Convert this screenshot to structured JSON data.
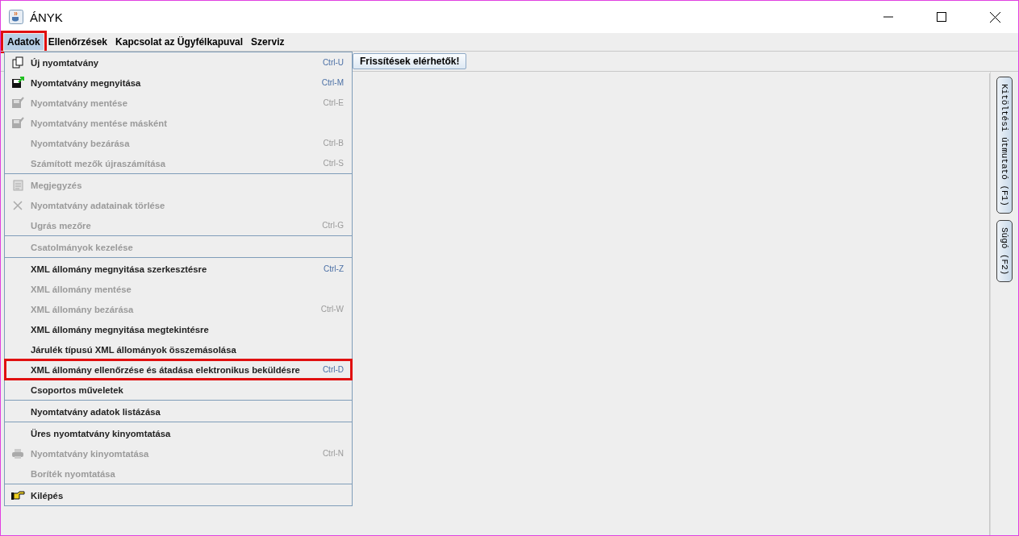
{
  "window": {
    "title": "ÁNYK"
  },
  "menubar": [
    {
      "label": "Adatok",
      "selected": true,
      "highlighted": true
    },
    {
      "label": "Ellenőrzések",
      "selected": false,
      "highlighted": false
    },
    {
      "label": "Kapcsolat az Ügyfélkapuval",
      "selected": false,
      "highlighted": false
    },
    {
      "label": "Szerviz",
      "selected": false,
      "highlighted": false
    }
  ],
  "toolbar": {
    "update_button": "Frissítések elérhetők!"
  },
  "menu": {
    "groups": [
      [
        {
          "label": "Új nyomtatvány",
          "shortcut": "Ctrl-U",
          "disabled": false,
          "highlighted": false,
          "kind": "pages"
        },
        {
          "label": "Nyomtatvány megnyitása",
          "shortcut": "Ctrl-M",
          "disabled": false,
          "highlighted": false,
          "kind": "open"
        },
        {
          "label": "Nyomtatvány mentése",
          "shortcut": "Ctrl-E",
          "disabled": true,
          "highlighted": false,
          "kind": "save"
        },
        {
          "label": "Nyomtatvány mentése másként",
          "disabled": true,
          "highlighted": false,
          "kind": "save"
        },
        {
          "label": "Nyomtatvány bezárása",
          "shortcut": "Ctrl-B",
          "disabled": true,
          "highlighted": false
        },
        {
          "label": "Számított mezők újraszámítása",
          "shortcut": "Ctrl-S",
          "disabled": true,
          "highlighted": false
        }
      ],
      [
        {
          "label": "Megjegyzés",
          "disabled": true,
          "highlighted": false,
          "kind": "note"
        },
        {
          "label": "Nyomtatvány adatainak törlése",
          "disabled": true,
          "highlighted": false,
          "kind": "cross"
        },
        {
          "label": "Ugrás mezőre",
          "shortcut": "Ctrl-G",
          "disabled": true,
          "highlighted": false
        }
      ],
      [
        {
          "label": "Csatolmányok kezelése",
          "disabled": true,
          "highlighted": false
        }
      ],
      [
        {
          "label": "XML állomány megnyitása szerkesztésre",
          "shortcut": "Ctrl-Z",
          "disabled": false,
          "highlighted": false
        },
        {
          "label": "XML állomány mentése",
          "disabled": true,
          "highlighted": false
        },
        {
          "label": "XML állomány bezárása",
          "shortcut": "Ctrl-W",
          "disabled": true,
          "highlighted": false
        },
        {
          "label": "XML állomány megnyitása megtekintésre",
          "disabled": false,
          "highlighted": false
        },
        {
          "label": "Járulék típusú XML állományok összemásolása",
          "disabled": false,
          "highlighted": false
        },
        {
          "label": "XML állomány ellenőrzése és átadása elektronikus beküldésre",
          "shortcut": "Ctrl-D",
          "disabled": false,
          "highlighted": true
        },
        {
          "label": "Csoportos műveletek",
          "disabled": false,
          "highlighted": false
        }
      ],
      [
        {
          "label": "Nyomtatvány adatok listázása",
          "disabled": false,
          "highlighted": false
        }
      ],
      [
        {
          "label": "Üres nyomtatvány kinyomtatása",
          "disabled": false,
          "highlighted": false
        },
        {
          "label": "Nyomtatvány kinyomtatása",
          "shortcut": "Ctrl-N",
          "disabled": true,
          "highlighted": false,
          "kind": "printer"
        },
        {
          "label": "Boríték nyomtatása",
          "disabled": true,
          "highlighted": false
        }
      ],
      [
        {
          "label": "Kilépés",
          "disabled": false,
          "highlighted": false,
          "kind": "hand"
        }
      ]
    ]
  },
  "side_tabs": [
    "Kitöltési útmutató (F1)",
    "Súgó (F2)"
  ]
}
